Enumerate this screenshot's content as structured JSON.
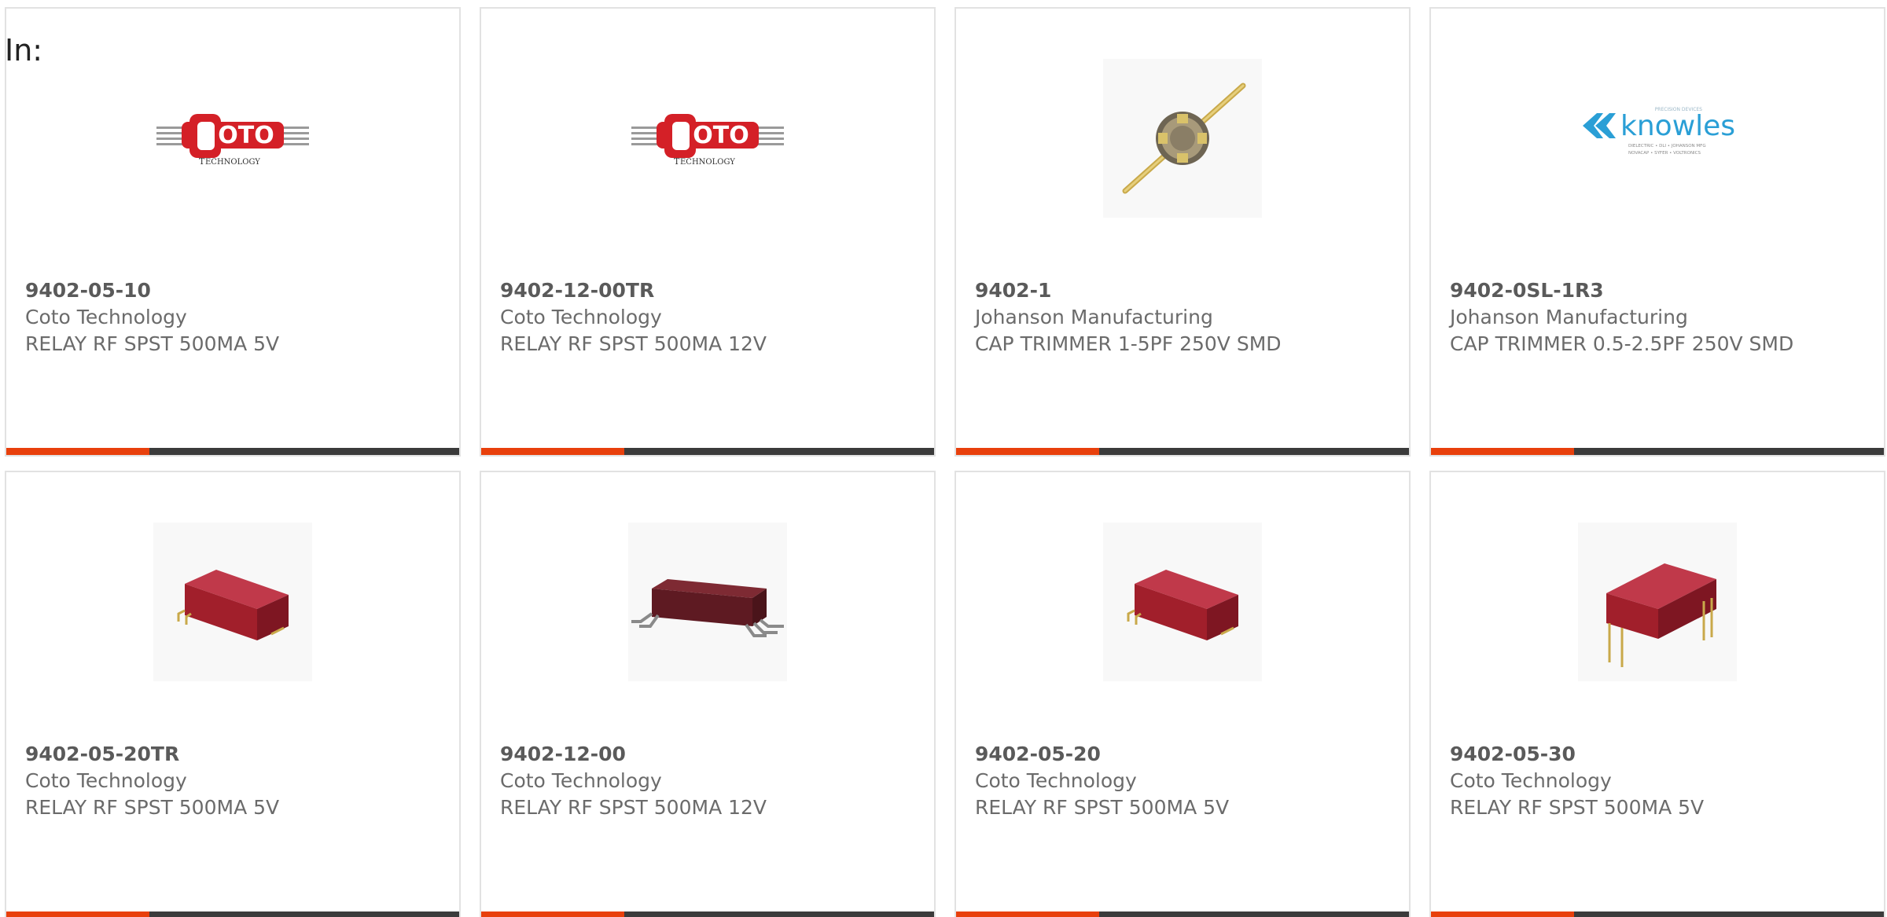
{
  "filter": {
    "in_label": "In:"
  },
  "products": [
    {
      "part_number": "9402-05-10",
      "manufacturer": "Coto Technology",
      "description": "RELAY RF SPST 500MA 5V",
      "image": "coto-logo"
    },
    {
      "part_number": "9402-12-00TR",
      "manufacturer": "Coto Technology",
      "description": "RELAY RF SPST 500MA 12V",
      "image": "coto-logo"
    },
    {
      "part_number": "9402-1",
      "manufacturer": "Johanson Manufacturing",
      "description": "CAP TRIMMER 1-5PF 250V SMD",
      "image": "trimmer-capacitor-photo"
    },
    {
      "part_number": "9402-0SL-1R3",
      "manufacturer": "Johanson Manufacturing",
      "description": "CAP TRIMMER 0.5-2.5PF 250V SMD",
      "image": "knowles-logo"
    },
    {
      "part_number": "9402-05-20TR",
      "manufacturer": "Coto Technology",
      "description": "RELAY RF SPST 500MA 5V",
      "image": "red-relay-photo"
    },
    {
      "part_number": "9402-12-00",
      "manufacturer": "Coto Technology",
      "description": "RELAY RF SPST 500MA 12V",
      "image": "smd-relay-photo"
    },
    {
      "part_number": "9402-05-20",
      "manufacturer": "Coto Technology",
      "description": "RELAY RF SPST 500MA 5V",
      "image": "red-relay-photo"
    },
    {
      "part_number": "9402-05-30",
      "manufacturer": "Coto Technology",
      "description": "RELAY RF SPST 500MA 5V",
      "image": "through-hole-relay-photo"
    }
  ],
  "logos": {
    "coto": {
      "main": "OTO",
      "sub": "ECHNOLOGY"
    },
    "knowles": {
      "name": "knowles",
      "tagline1": "PRECISION DEVICES",
      "tagline2": "DIELECTRIC • DLI • JOHANSON MFG",
      "tagline3": "NOVACAP • SYFER • VOLTRONICS"
    }
  },
  "colors": {
    "accent_bar": "#e8400c",
    "base_bar": "#3b3b3b",
    "coto_red": "#d42027",
    "knowles_blue": "#2a9fd6",
    "relay_red": "#a11f2b"
  }
}
